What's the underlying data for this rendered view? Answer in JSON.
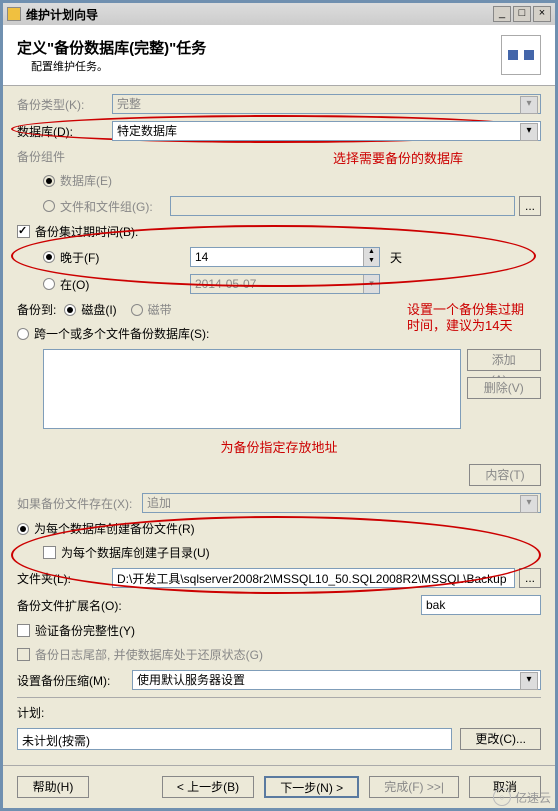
{
  "window": {
    "title": "维护计划向导"
  },
  "header": {
    "title": "定义\"备份数据库(完整)\"任务",
    "subtitle": "配置维护任务。"
  },
  "backup_type": {
    "label": "备份类型(K):",
    "value": "完整"
  },
  "database": {
    "label": "数据库(D):",
    "value": "特定数据库"
  },
  "components": {
    "label": "备份组件",
    "database": "数据库(E)",
    "filegroup": "文件和文件组(G):"
  },
  "expire": {
    "label": "备份集过期时间(B):",
    "after_label": "晚于(F)",
    "after_value": "14",
    "after_unit": "天",
    "on_label": "在(O)",
    "on_value": "2014-05-07"
  },
  "annotations": {
    "select_db": "选择需要备份的数据库",
    "expire_note1": "设置一个备份集过期",
    "expire_note2": "时间，建议为14天",
    "path_note": "为备份指定存放地址"
  },
  "backup_to": {
    "label": "备份到:",
    "disk": "磁盘(I)",
    "tape": "磁带"
  },
  "dest": {
    "span": "跨一个或多个文件备份数据库(S):",
    "add": "添加(A)...",
    "remove": "删除(V)",
    "contents": "内容(T)"
  },
  "if_exists": {
    "label": "如果备份文件存在(X):",
    "value": "追加"
  },
  "per_db": {
    "create_file": "为每个数据库创建备份文件(R)",
    "create_subdir": "为每个数据库创建子目录(U)",
    "folder_label": "文件夹(L):",
    "folder_value": "D:\\开发工具\\sqlserver2008r2\\MSSQL10_50.SQL2008R2\\MSSQL\\Backup",
    "ext_label": "备份文件扩展名(O):",
    "ext_value": "bak"
  },
  "verify": "验证备份完整性(Y)",
  "tail_log": "备份日志尾部, 并使数据库处于还原状态(G)",
  "compression": {
    "label": "设置备份压缩(M):",
    "value": "使用默认服务器设置"
  },
  "plan": {
    "label": "计划:",
    "value": "未计划(按需)",
    "change": "更改(C)..."
  },
  "footer": {
    "help": "帮助(H)",
    "back": "< 上一步(B)",
    "next": "下一步(N) >",
    "finish": "完成(F) >>|",
    "cancel": "取消"
  },
  "watermark": "亿速云"
}
